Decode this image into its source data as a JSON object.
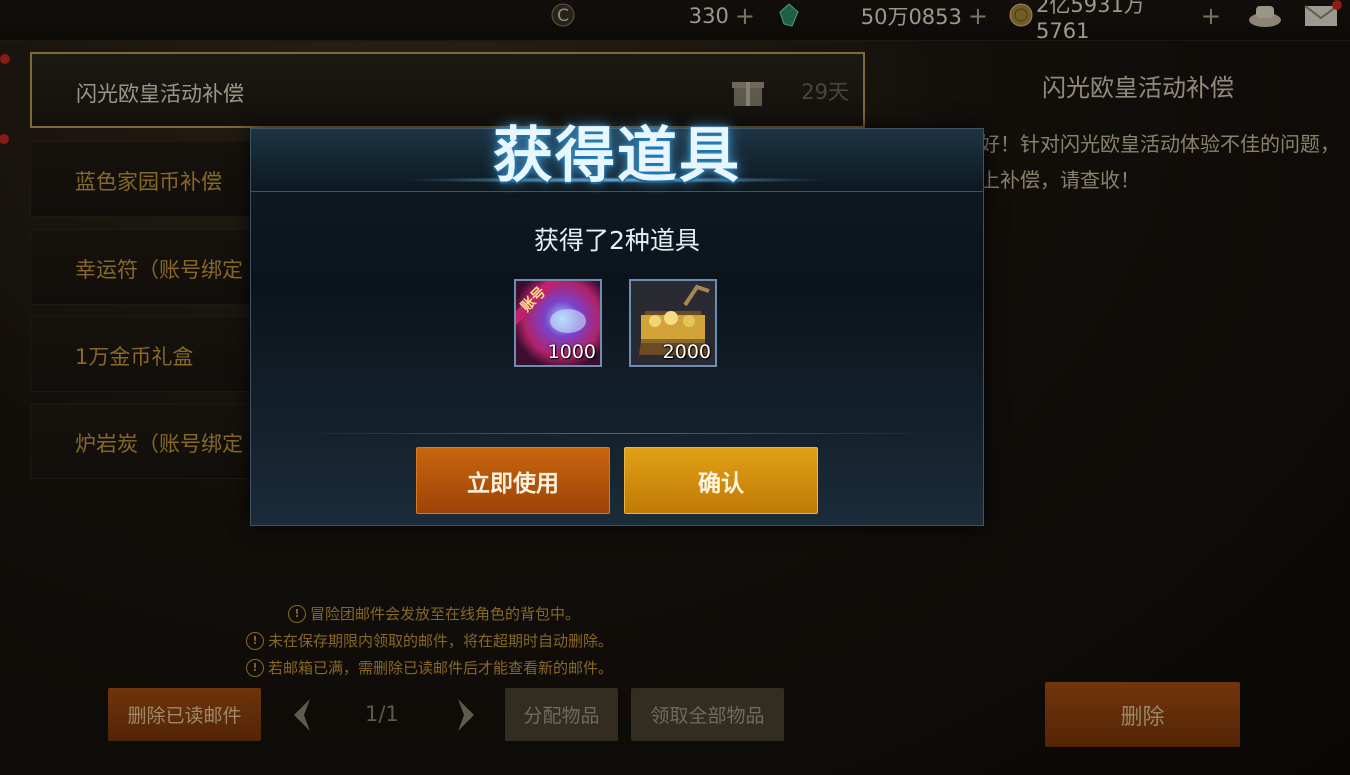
{
  "currencies": [
    {
      "icon": "coin-c-icon",
      "value": "330"
    },
    {
      "icon": "green-gem-icon",
      "value": "50万0853"
    },
    {
      "icon": "gold-coin-icon",
      "value": "2亿5931万5761"
    }
  ],
  "mail_list": [
    {
      "title": "闪光欧皇活动补偿",
      "days": "29天",
      "selected": true
    },
    {
      "title": "蓝色家园币补偿"
    },
    {
      "title": "幸运符（账号绑定"
    },
    {
      "title": "1万金币礼盒"
    },
    {
      "title": "炉岩炭（账号绑定"
    }
  ],
  "detail": {
    "title": "闪光欧皇活动补偿",
    "body_line1": "好！针对闪光欧皇活动体验不佳的问题，",
    "body_line2": "上补偿，请查收！"
  },
  "notes": [
    "冒险团邮件会发放至在线角色的背包中。",
    "未在保存期限内领取的邮件，将在超期时自动删除。",
    "若邮箱已满，需删除已读邮件后才能查看新的邮件。"
  ],
  "bottom": {
    "delete_read": "删除已读邮件",
    "page": "1/1",
    "distribute": "分配物品",
    "claim_all": "领取全部物品",
    "delete": "删除"
  },
  "dialog": {
    "title": "获得道具",
    "subtitle": "获得了2种道具",
    "items": [
      {
        "icon": "account-ticket-icon",
        "badge": "账号",
        "qty": "1000"
      },
      {
        "icon": "gold-chest-icon",
        "qty": "2000"
      }
    ],
    "use_now": "立即使用",
    "confirm": "确认"
  },
  "colors": {
    "accent_orange": "#c8650e",
    "confirm_gold": "#e2a017",
    "mail_title_gold": "#c79a3a"
  }
}
